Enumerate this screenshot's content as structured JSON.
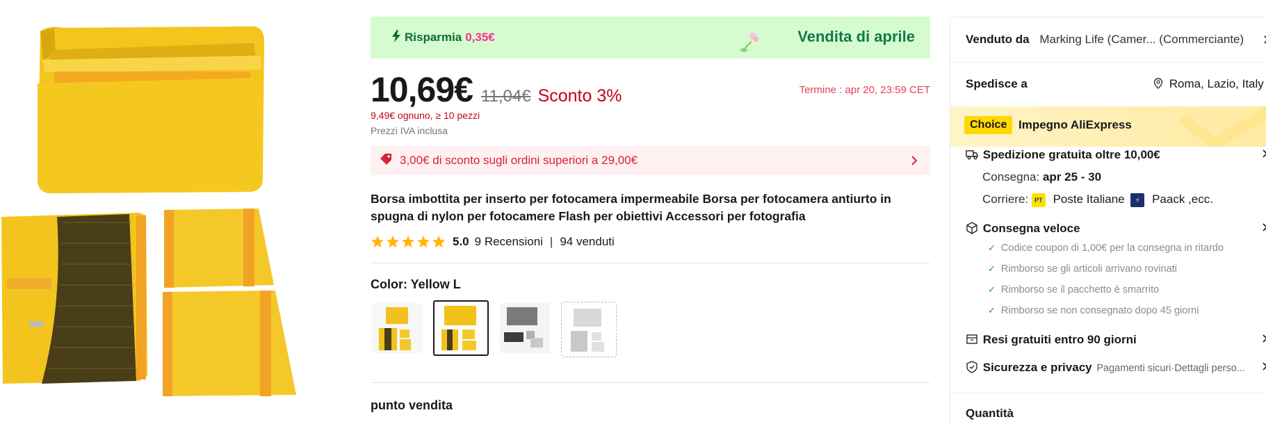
{
  "promo": {
    "save_label": "Risparmia",
    "save_amount": "0,35€",
    "banner_title": "Vendita di aprile"
  },
  "pricing": {
    "price": "10,69€",
    "old_price": "11,04€",
    "discount": "Sconto 3%",
    "deadline": "Termine :  apr 20, 23:59 CET",
    "bulk_price": "9,49€ ognuno, ≥ 10 pezzi",
    "vat_note": "Prezzi IVA inclusa"
  },
  "coupon": {
    "text": "3,00€ di sconto sugli ordini superiori a 29,00€"
  },
  "product": {
    "title": "Borsa imbottita per inserto per fotocamera impermeabile Borsa per fotocamera antiurto in spugna di nylon per fotocamere Flash per obiettivi Accessori per fotografia",
    "rating": "5.0",
    "reviews": "9 Recensioni",
    "sold": "94 venduti",
    "color_label": "Color: ",
    "color_value": "Yellow L",
    "section_title": "punto vendita"
  },
  "swatches": [
    {
      "name": "Yellow S",
      "color": "#f2c21c",
      "selected": false
    },
    {
      "name": "Yellow L",
      "color": "#f2c21c",
      "selected": true
    },
    {
      "name": "Gray",
      "color": "#8a8a8a",
      "selected": false
    },
    {
      "name": "Light Gray",
      "color": "#d0d0d0",
      "selected": false
    }
  ],
  "seller": {
    "label": "Venduto da",
    "name": "Marking Life (Camer... (Commerciante)"
  },
  "ship_to": {
    "label": "Spedisce a",
    "location": "Roma, Lazio, Italy"
  },
  "choice": {
    "badge": "Choice",
    "text": "Impegno AliExpress"
  },
  "shipping": {
    "title": "Spedizione gratuita oltre 10,00€",
    "delivery_label": "Consegna: ",
    "delivery_value": "apr 25 - 30",
    "carrier_label": "Corriere: ",
    "carrier1": "Poste Italiane",
    "carrier2": "Paack ,ecc."
  },
  "fast_delivery": {
    "title": "Consegna veloce",
    "bullets": [
      "Codice coupon di 1,00€ per la consegna in ritardo",
      "Rimborso se gli articoli arrivano rovinati",
      "Rimborso se il pacchetto è smarrito",
      "Rimborso se non consegnato dopo 45 giorni"
    ]
  },
  "returns": {
    "title": "Resi gratuiti entro 90 giorni"
  },
  "security": {
    "title": "Sicurezza e privacy",
    "detail": "Pagamenti sicuri·Dettagli perso..."
  },
  "quantity": {
    "label": "Quantità"
  },
  "colors": {
    "price_red": "#c4001d",
    "promo_green_bg": "#d5fbcf",
    "promo_green_text": "#117a47",
    "pink": "#ff2d91",
    "coupon_bg": "#fff0f1",
    "star": "#ffb800",
    "choice_yellow": "#ffd800"
  }
}
